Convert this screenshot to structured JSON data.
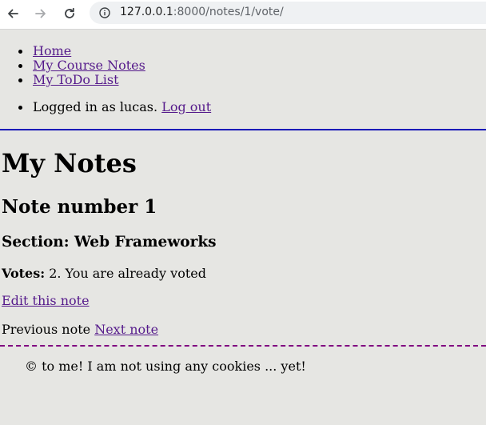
{
  "browser": {
    "url_host": "127.0.0.1",
    "url_path": ":8000/notes/1/vote/"
  },
  "menu": {
    "home": "Home",
    "course_notes": "My Course Notes",
    "todo": "My ToDo List",
    "logged_in_text": "Logged in as lucas.",
    "logout": "Log out"
  },
  "main": {
    "title": "My Notes",
    "note_heading": "Note number 1",
    "section_heading": "Section: Web Frameworks",
    "votes_label": "Votes:",
    "votes_text": "2. You are already voted",
    "edit_link": "Edit this note",
    "previous_note": "Previous note",
    "next_note": "Next note"
  },
  "footer": {
    "text": "© to me! I am not using any cookies ... yet!"
  },
  "colors": {
    "page_background": "#e6e6e3",
    "link": "#551a8b",
    "header_rule": "#1a1ab8",
    "footer_rule": "#800080"
  }
}
